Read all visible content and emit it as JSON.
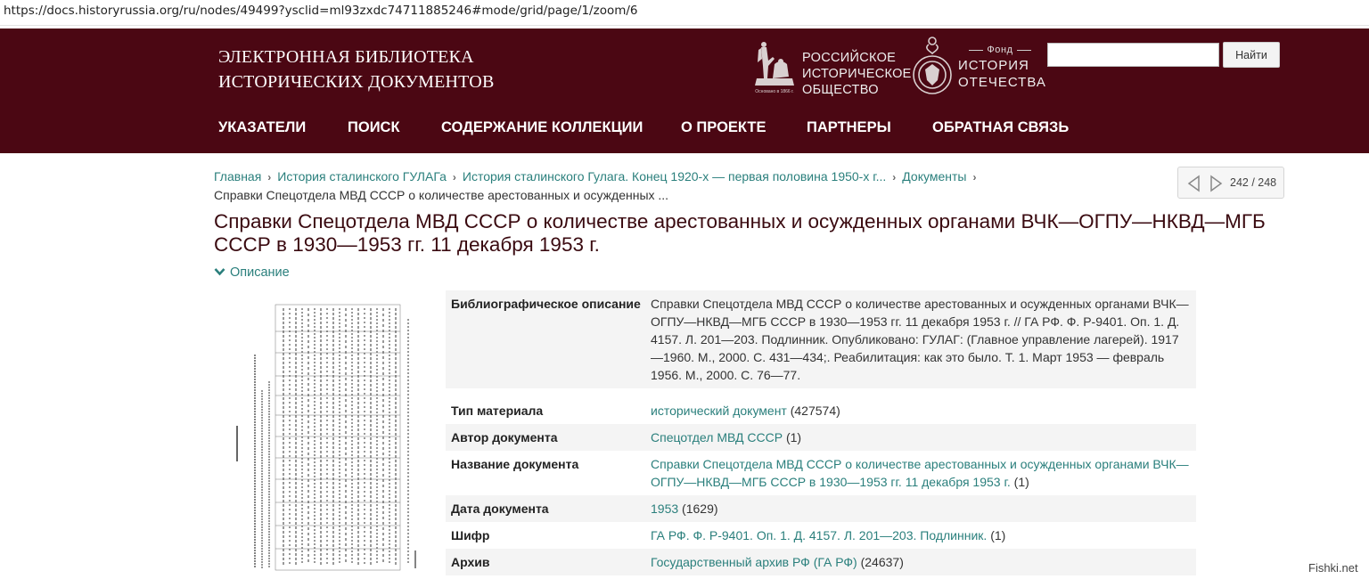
{
  "browser": {
    "url": "https://docs.historyrussia.org/ru/nodes/49499?ysclid=ml93zxdc74711885246#mode/grid/page/1/zoom/6"
  },
  "header": {
    "site_title_line1": "ЭЛЕКТРОННАЯ БИБЛИОТЕКА",
    "site_title_line2": "ИСТОРИЧЕСКИХ ДОКУМЕНТОВ",
    "rio_line1": "РОССИЙСКОЕ",
    "rio_line2": "ИСТОРИЧЕСКОЕ",
    "rio_line3": "ОБЩЕСТВО",
    "fond_small": "Фонд",
    "fond_line1": "ИСТОРИЯ",
    "fond_line2": "ОТЕЧЕСТВА",
    "search_placeholder": "",
    "search_button": "Найти"
  },
  "nav": [
    "УКАЗАТЕЛИ",
    "ПОИСК",
    "СОДЕРЖАНИЕ КОЛЛЕКЦИИ",
    "О ПРОЕКТЕ",
    "ПАРТНЕРЫ",
    "ОБРАТНАЯ СВЯЗЬ"
  ],
  "breadcrumb": {
    "items": [
      "Главная",
      "История сталинского ГУЛАГа",
      "История сталинского Гулага. Конец 1920-х — первая половина 1950-х г...",
      "Документы"
    ],
    "current": "Справки Спецотдела МВД СССР о количестве арестованных и осужденных ..."
  },
  "pager": {
    "count": "242 / 248"
  },
  "title": {
    "line1": "Справки Спецотдела МВД СССР о количестве арестованных и осужденных органами ВЧК—ОГПУ—НКВД—МГБ",
    "line2": "СССР в 1930—1953 гг. 11 декабря 1953 г."
  },
  "description_toggle": "Описание",
  "meta": {
    "biblio_label": "Библиографическое описание",
    "biblio_l1": "Справки Спецотдела МВД СССР о количестве арестованных и осужденных органами ВЧК—",
    "biblio_l2": "ОГПУ—НКВД—МГБ СССР в 1930—1953 гг. 11 декабря 1953 г. // ГА РФ. Ф. Р-9401. Оп. 1. Д.",
    "biblio_l3": "4157. Л. 201—203. Подлинник. Опубликовано: ГУЛАГ: (Главное управление лагерей). 1917",
    "biblio_l4": "—1960. М., 2000. С. 431—434;. Реабилитация: как это было. Т. 1. Март 1953 — февраль",
    "biblio_l5": "1956. М., 2000. С. 76—77.",
    "type_label": "Тип материала",
    "type_link": "исторический документ",
    "type_count": "(427574)",
    "author_label": "Автор документа",
    "author_link": "Спецотдел МВД СССР",
    "author_count": "(1)",
    "name_label": "Название документа",
    "name_l1": "Справки Спецотдела МВД СССР о количестве арестованных и осужденных органами ВЧК—",
    "name_l2": "ОГПУ—НКВД—МГБ СССР в 1930—1953 гг. 11 декабря 1953 г.",
    "name_count": "(1)",
    "date_label": "Дата документа",
    "date_link": "1953",
    "date_count": "(1629)",
    "cipher_label": "Шифр",
    "cipher_link": "ГА РФ. Ф. Р-9401. Оп. 1. Д. 4157. Л. 201—203. Подлинник.",
    "cipher_count": "(1)",
    "archive_label": "Архив",
    "archive_link": "Государственный архив РФ (ГА РФ)",
    "archive_count": "(24637)"
  },
  "watermark": "Fishki.net"
}
